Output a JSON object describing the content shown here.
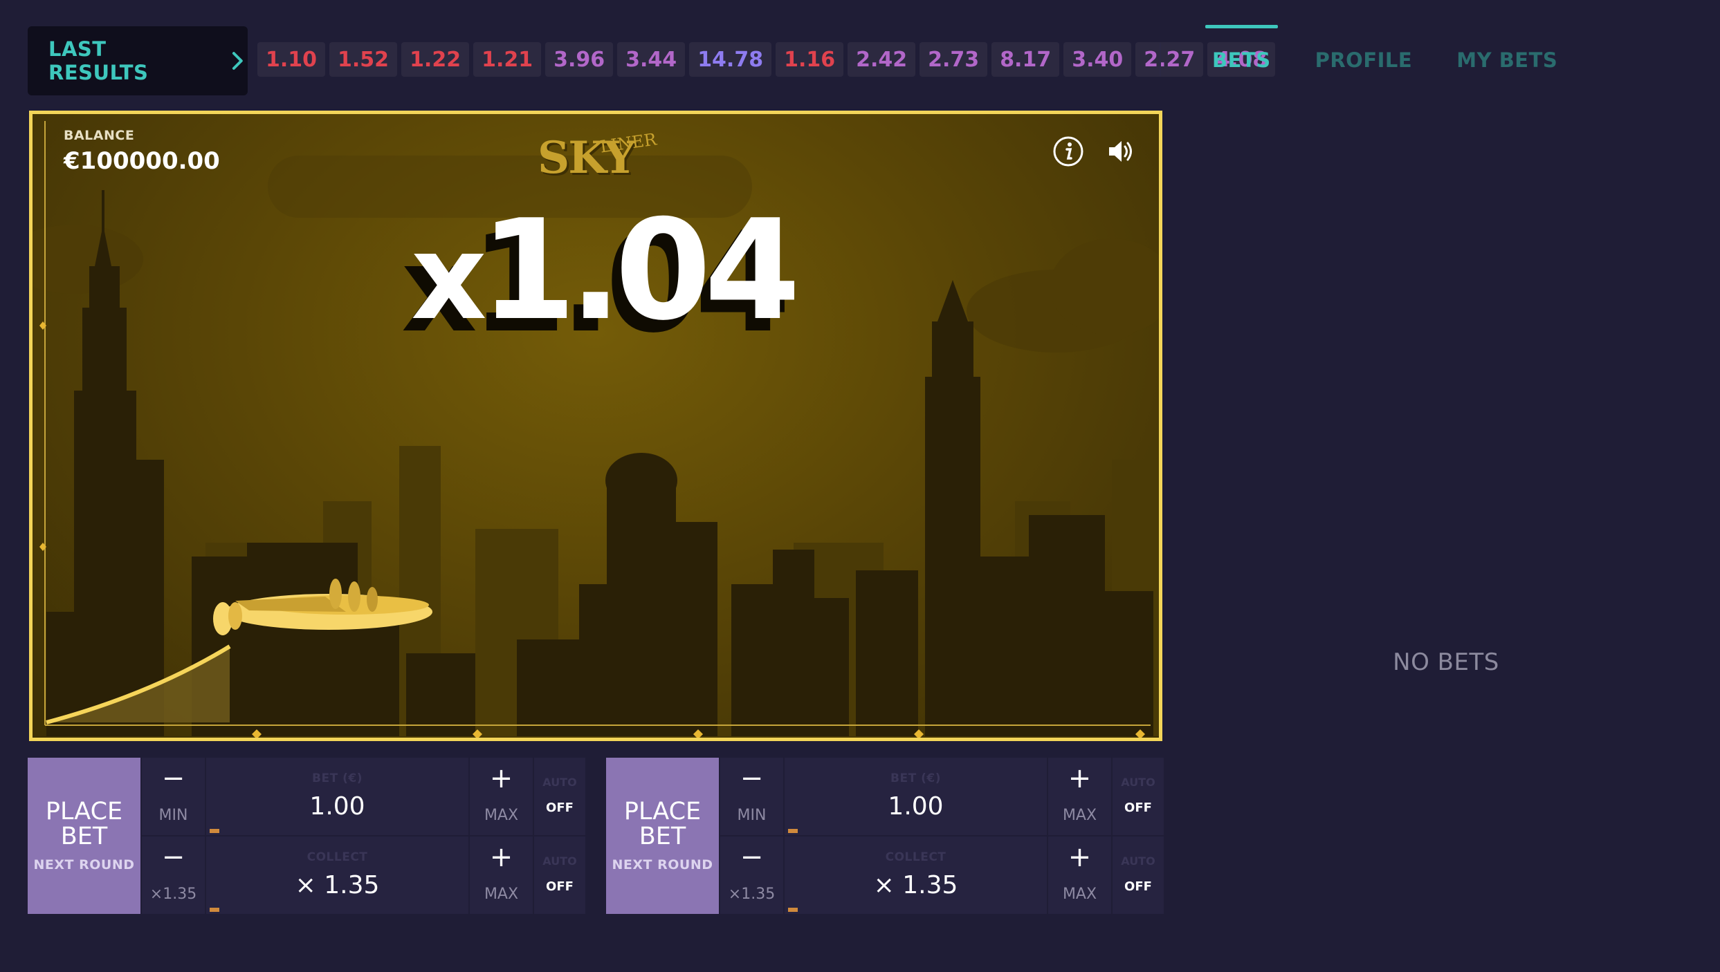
{
  "header": {
    "last_results_label": "LAST RESULTS",
    "results": [
      {
        "value": "1.10",
        "color": "#e0424e"
      },
      {
        "value": "1.52",
        "color": "#e0424e"
      },
      {
        "value": "1.22",
        "color": "#e0424e"
      },
      {
        "value": "1.21",
        "color": "#e0424e"
      },
      {
        "value": "3.96",
        "color": "#b267c9"
      },
      {
        "value": "3.44",
        "color": "#b267c9"
      },
      {
        "value": "14.78",
        "color": "#8e7cf0"
      },
      {
        "value": "1.16",
        "color": "#e0424e"
      },
      {
        "value": "2.42",
        "color": "#b267c9"
      },
      {
        "value": "2.73",
        "color": "#b267c9"
      },
      {
        "value": "8.17",
        "color": "#b267c9"
      },
      {
        "value": "3.40",
        "color": "#b267c9"
      },
      {
        "value": "2.27",
        "color": "#b267c9"
      },
      {
        "value": "4.08",
        "color": "#b267c9"
      }
    ]
  },
  "tabs": [
    {
      "label": "BETS",
      "active": true
    },
    {
      "label": "PROFILE",
      "active": false
    },
    {
      "label": "MY BETS",
      "active": false
    }
  ],
  "bets_panel": {
    "empty_text": "NO BETS"
  },
  "game": {
    "balance_label": "BALANCE",
    "balance_value": "€100000.00",
    "logo_text": "SKY",
    "logo_sub": "LINER",
    "multiplier_prefix": "x",
    "multiplier": "1.04",
    "icons": [
      "info-icon",
      "speaker-icon",
      "plane-icon"
    ]
  },
  "bet_panels": [
    {
      "place_label": "PLACE BET",
      "next_round_label": "NEXT ROUND",
      "bet_row": {
        "minus": "−",
        "minus_sub": "MIN",
        "label": "BET (€)",
        "value": "1.00",
        "plus": "+",
        "plus_sub": "MAX",
        "auto_label": "AUTO",
        "auto_value": "OFF"
      },
      "collect_row": {
        "minus": "−",
        "minus_sub": "×1.35",
        "label": "COLLECT",
        "value": "× 1.35",
        "plus": "+",
        "plus_sub": "MAX",
        "auto_label": "AUTO",
        "auto_value": "OFF"
      }
    },
    {
      "place_label": "PLACE BET",
      "next_round_label": "NEXT ROUND",
      "bet_row": {
        "minus": "−",
        "minus_sub": "MIN",
        "label": "BET (€)",
        "value": "1.00",
        "plus": "+",
        "plus_sub": "MAX",
        "auto_label": "AUTO",
        "auto_value": "OFF"
      },
      "collect_row": {
        "minus": "−",
        "minus_sub": "×1.35",
        "label": "COLLECT",
        "value": "× 1.35",
        "plus": "+",
        "plus_sub": "MAX",
        "auto_label": "AUTO",
        "auto_value": "OFF"
      }
    }
  ],
  "colors": {
    "accent": "#3ec7bd",
    "place_bet": "#8b75b3",
    "frame": "#f3d559"
  }
}
